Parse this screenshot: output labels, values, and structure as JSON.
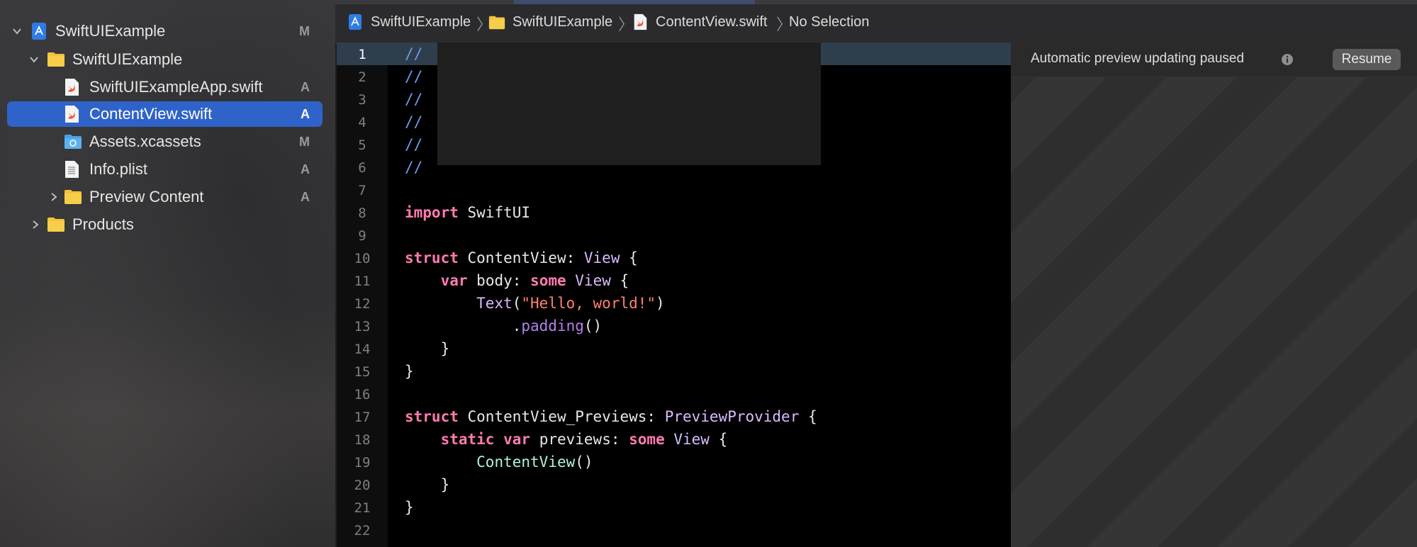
{
  "navigator": {
    "items": [
      {
        "label": "SwiftUIExample",
        "status": "M",
        "kind": "project",
        "expanded": true,
        "level": 0
      },
      {
        "label": "SwiftUIExample",
        "status": "",
        "kind": "folder",
        "expanded": true,
        "level": 1
      },
      {
        "label": "SwiftUIExampleApp.swift",
        "status": "A",
        "kind": "swift-file",
        "level": 2
      },
      {
        "label": "ContentView.swift",
        "status": "A",
        "kind": "swift-file",
        "level": 2,
        "selected": true
      },
      {
        "label": "Assets.xcassets",
        "status": "M",
        "kind": "assets",
        "level": 2
      },
      {
        "label": "Info.plist",
        "status": "A",
        "kind": "plist",
        "level": 2
      },
      {
        "label": "Preview Content",
        "status": "A",
        "kind": "folder",
        "expanded": false,
        "level": 2
      },
      {
        "label": "Products",
        "status": "",
        "kind": "folder",
        "expanded": false,
        "level": 1
      }
    ]
  },
  "breadcrumb": {
    "items": [
      "SwiftUIExample",
      "SwiftUIExample",
      "ContentView.swift",
      "No Selection"
    ]
  },
  "editor": {
    "current_line": 1,
    "line_numbers": [
      "1",
      "2",
      "3",
      "4",
      "5",
      "6",
      "7",
      "8",
      "9",
      "10",
      "11",
      "12",
      "13",
      "14",
      "15",
      "16",
      "17",
      "18",
      "19",
      "20",
      "21",
      "22"
    ],
    "tokens": {
      "comment": "//",
      "import_kw": "import",
      "import_mod": "SwiftUI",
      "struct_kw": "struct",
      "content_view": "ContentView",
      "view_type": "View",
      "open_brace": "{",
      "close_brace": "}",
      "var_kw": "var",
      "body": "body",
      "some_kw": "some",
      "text_call": "Text",
      "hello_str": "\"Hello, world!\"",
      "padding": "padding",
      "previews_struct": "ContentView_Previews",
      "preview_provider": "PreviewProvider",
      "static_kw": "static",
      "previews": "previews",
      "content_view_call": "ContentView"
    }
  },
  "preview": {
    "message": "Automatic preview updating paused",
    "resume_label": "Resume"
  },
  "colors": {
    "selection": "#2f63c9",
    "keyword": "#ff7ab2",
    "type": "#dabaff",
    "string": "#ff8170",
    "comment": "#6c9cf0",
    "current_line": "#2e3e4c"
  }
}
